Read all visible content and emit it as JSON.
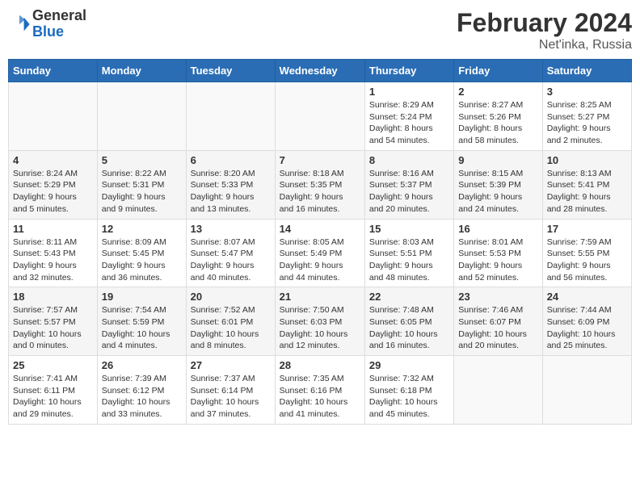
{
  "logo": {
    "general": "General",
    "blue": "Blue"
  },
  "header": {
    "month_year": "February 2024",
    "location": "Net'inka, Russia"
  },
  "weekdays": [
    "Sunday",
    "Monday",
    "Tuesday",
    "Wednesday",
    "Thursday",
    "Friday",
    "Saturday"
  ],
  "weeks": [
    [
      {
        "day": "",
        "info": ""
      },
      {
        "day": "",
        "info": ""
      },
      {
        "day": "",
        "info": ""
      },
      {
        "day": "",
        "info": ""
      },
      {
        "day": "1",
        "info": "Sunrise: 8:29 AM\nSunset: 5:24 PM\nDaylight: 8 hours\nand 54 minutes."
      },
      {
        "day": "2",
        "info": "Sunrise: 8:27 AM\nSunset: 5:26 PM\nDaylight: 8 hours\nand 58 minutes."
      },
      {
        "day": "3",
        "info": "Sunrise: 8:25 AM\nSunset: 5:27 PM\nDaylight: 9 hours\nand 2 minutes."
      }
    ],
    [
      {
        "day": "4",
        "info": "Sunrise: 8:24 AM\nSunset: 5:29 PM\nDaylight: 9 hours\nand 5 minutes."
      },
      {
        "day": "5",
        "info": "Sunrise: 8:22 AM\nSunset: 5:31 PM\nDaylight: 9 hours\nand 9 minutes."
      },
      {
        "day": "6",
        "info": "Sunrise: 8:20 AM\nSunset: 5:33 PM\nDaylight: 9 hours\nand 13 minutes."
      },
      {
        "day": "7",
        "info": "Sunrise: 8:18 AM\nSunset: 5:35 PM\nDaylight: 9 hours\nand 16 minutes."
      },
      {
        "day": "8",
        "info": "Sunrise: 8:16 AM\nSunset: 5:37 PM\nDaylight: 9 hours\nand 20 minutes."
      },
      {
        "day": "9",
        "info": "Sunrise: 8:15 AM\nSunset: 5:39 PM\nDaylight: 9 hours\nand 24 minutes."
      },
      {
        "day": "10",
        "info": "Sunrise: 8:13 AM\nSunset: 5:41 PM\nDaylight: 9 hours\nand 28 minutes."
      }
    ],
    [
      {
        "day": "11",
        "info": "Sunrise: 8:11 AM\nSunset: 5:43 PM\nDaylight: 9 hours\nand 32 minutes."
      },
      {
        "day": "12",
        "info": "Sunrise: 8:09 AM\nSunset: 5:45 PM\nDaylight: 9 hours\nand 36 minutes."
      },
      {
        "day": "13",
        "info": "Sunrise: 8:07 AM\nSunset: 5:47 PM\nDaylight: 9 hours\nand 40 minutes."
      },
      {
        "day": "14",
        "info": "Sunrise: 8:05 AM\nSunset: 5:49 PM\nDaylight: 9 hours\nand 44 minutes."
      },
      {
        "day": "15",
        "info": "Sunrise: 8:03 AM\nSunset: 5:51 PM\nDaylight: 9 hours\nand 48 minutes."
      },
      {
        "day": "16",
        "info": "Sunrise: 8:01 AM\nSunset: 5:53 PM\nDaylight: 9 hours\nand 52 minutes."
      },
      {
        "day": "17",
        "info": "Sunrise: 7:59 AM\nSunset: 5:55 PM\nDaylight: 9 hours\nand 56 minutes."
      }
    ],
    [
      {
        "day": "18",
        "info": "Sunrise: 7:57 AM\nSunset: 5:57 PM\nDaylight: 10 hours\nand 0 minutes."
      },
      {
        "day": "19",
        "info": "Sunrise: 7:54 AM\nSunset: 5:59 PM\nDaylight: 10 hours\nand 4 minutes."
      },
      {
        "day": "20",
        "info": "Sunrise: 7:52 AM\nSunset: 6:01 PM\nDaylight: 10 hours\nand 8 minutes."
      },
      {
        "day": "21",
        "info": "Sunrise: 7:50 AM\nSunset: 6:03 PM\nDaylight: 10 hours\nand 12 minutes."
      },
      {
        "day": "22",
        "info": "Sunrise: 7:48 AM\nSunset: 6:05 PM\nDaylight: 10 hours\nand 16 minutes."
      },
      {
        "day": "23",
        "info": "Sunrise: 7:46 AM\nSunset: 6:07 PM\nDaylight: 10 hours\nand 20 minutes."
      },
      {
        "day": "24",
        "info": "Sunrise: 7:44 AM\nSunset: 6:09 PM\nDaylight: 10 hours\nand 25 minutes."
      }
    ],
    [
      {
        "day": "25",
        "info": "Sunrise: 7:41 AM\nSunset: 6:11 PM\nDaylight: 10 hours\nand 29 minutes."
      },
      {
        "day": "26",
        "info": "Sunrise: 7:39 AM\nSunset: 6:12 PM\nDaylight: 10 hours\nand 33 minutes."
      },
      {
        "day": "27",
        "info": "Sunrise: 7:37 AM\nSunset: 6:14 PM\nDaylight: 10 hours\nand 37 minutes."
      },
      {
        "day": "28",
        "info": "Sunrise: 7:35 AM\nSunset: 6:16 PM\nDaylight: 10 hours\nand 41 minutes."
      },
      {
        "day": "29",
        "info": "Sunrise: 7:32 AM\nSunset: 6:18 PM\nDaylight: 10 hours\nand 45 minutes."
      },
      {
        "day": "",
        "info": ""
      },
      {
        "day": "",
        "info": ""
      }
    ]
  ]
}
